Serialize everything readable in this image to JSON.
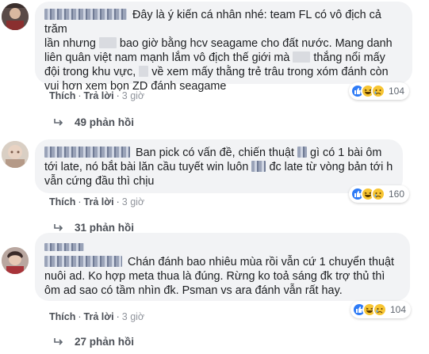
{
  "comments": [
    {
      "text_lines": [
        "Đây là ý kiến cá nhân nhé: team FL có vô địch cả trăm",
        "lần nhưng",
        "bao giờ bằng hcv seagame cho đất nước. Mang danh",
        "liên quân việt nam mạnh lắm vô địch thế giới mà",
        "thắng nổi mấy",
        "đội trong khu vực,",
        "về xem mấy thằng trẻ trâu trong xóm đánh còn",
        "vui hơn xem bọn ZD đánh seagame"
      ],
      "actions": {
        "like": "Thích",
        "reply": "Trả lời",
        "time": "3 giờ"
      },
      "reactions": {
        "icons": [
          "like-icon",
          "haha-icon",
          "sad-icon"
        ],
        "count": "104"
      },
      "replies": "49 phản hồi"
    },
    {
      "text_lines": [
        "Ban pick có vấn đề, chiến thuật",
        "gì có 1 bài ôm",
        "tới late, nó bắt bài lăn cầu tuyết win luôn",
        "đc late từ vòng bản tới h",
        "vẫn cứng đầu thì chịu"
      ],
      "actions": {
        "like": "Thích",
        "reply": "Trả lời",
        "time": "3 giờ"
      },
      "reactions": {
        "icons": [
          "like-icon",
          "haha-icon",
          "sad-icon"
        ],
        "count": "160"
      },
      "replies": "31 phản hồi"
    },
    {
      "text_lines": [
        "Chán đánh bao nhiêu mùa rồi vẫn cứ 1 chuyển thuật",
        "nuôi ad. Ko hợp meta thua là đúng. Rừng ko toả sáng đk trợ thủ thì",
        "ôm ad sao có tầm nhìn đk. Psman vs ara đánh vẫn rất hay."
      ],
      "actions": {
        "like": "Thích",
        "reply": "Trả lời",
        "time": "3 giờ"
      },
      "reactions": {
        "icons": [
          "like-icon",
          "haha-icon",
          "sad-icon"
        ],
        "count": "104"
      },
      "replies": "27 phản hồi"
    }
  ],
  "colors": {
    "bubble": "#f2f3f5",
    "link": "#385898",
    "like": "#2e7bf6",
    "emoji": "#f7c533"
  }
}
